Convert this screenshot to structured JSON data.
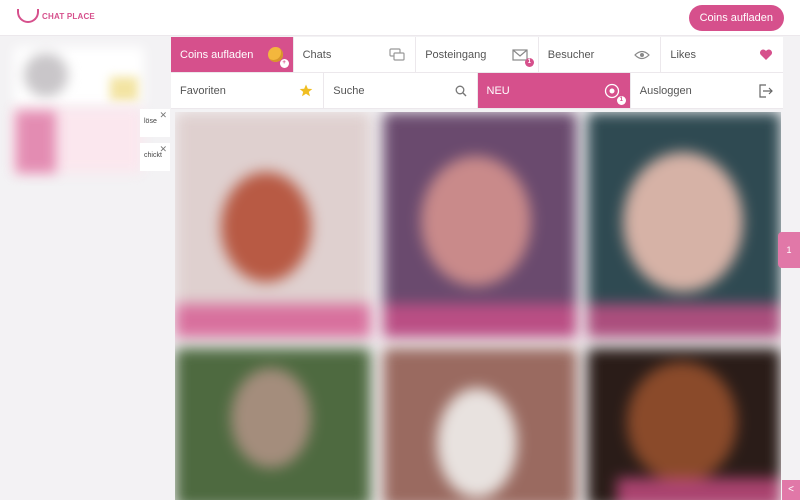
{
  "header": {
    "logo_text": "CHAT PLACE",
    "cta_label": "Coins aufladen"
  },
  "sidebar": {
    "notifications": [
      {
        "text": "löse"
      },
      {
        "text": "chickt"
      }
    ]
  },
  "nav": {
    "row1": [
      {
        "label": "Coins aufladen",
        "icon": "coin-plus-icon",
        "active": true
      },
      {
        "label": "Chats",
        "icon": "chat-bubbles-icon"
      },
      {
        "label": "Posteingang",
        "icon": "envelope-icon",
        "badge": "1"
      },
      {
        "label": "Besucher",
        "icon": "eye-icon"
      },
      {
        "label": "Likes",
        "icon": "heart-icon"
      }
    ],
    "row2": [
      {
        "label": "Favoriten",
        "icon": "star-icon"
      },
      {
        "label": "Suche",
        "icon": "search-icon"
      },
      {
        "label": "NEU",
        "icon": "new-badge-icon",
        "badge": "1",
        "active": true
      },
      {
        "label": "Ausloggen",
        "icon": "logout-icon"
      }
    ]
  },
  "side_tab": {
    "count": "1"
  },
  "corner_tab": {
    "label": "<"
  },
  "colors": {
    "accent": "#d6508c",
    "accent_light": "#e178a8"
  }
}
